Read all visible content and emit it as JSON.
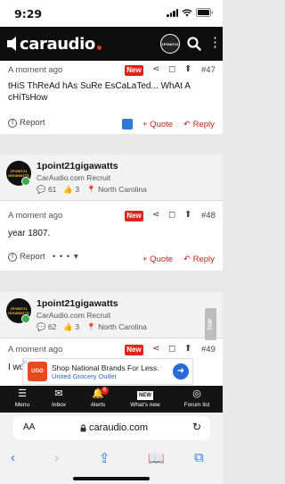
{
  "status_bar": {
    "time": "9:29"
  },
  "header": {
    "logo": "caraudio",
    "avatar_text": "1POINT21"
  },
  "posts": [
    {
      "time": "A moment ago",
      "badge": "New",
      "number": "#47",
      "body": "tHiS ThReAd hAs SuRe EsCaLaTed... WhAt A cHiTsHow",
      "report": "Report",
      "quote": "+ Quote",
      "reply": "Reply"
    },
    {
      "user": {
        "name": "1point21gigawatts",
        "title": "CarAudio.com Recruit",
        "messages": "61",
        "likes": "3",
        "location": "North Carolina",
        "avatar_text": "1POINT21 GIGAWATTS"
      },
      "time": "A moment ago",
      "badge": "New",
      "number": "#48",
      "body": "year 1807.",
      "report": "Report",
      "more": "• • •",
      "quote": "+ Quote",
      "reply": "Reply"
    },
    {
      "user": {
        "name": "1point21gigawatts",
        "title": "CarAudio.com Recruit",
        "messages": "62",
        "likes": "3",
        "location": "North Carolina",
        "avatar_text": "1POINT21 GIGAWATTS"
      },
      "time": "A moment ago",
      "badge": "New",
      "number": "#49",
      "body": "I wo"
    }
  ],
  "top_button": "TOP",
  "ad": {
    "title": "Shop National Brands For Less.",
    "subtitle": "United Grocery Outlet",
    "logo": "UGO"
  },
  "bottom_nav": [
    {
      "label": "Menu",
      "icon": "menu-icon"
    },
    {
      "label": "Inbox",
      "icon": "inbox-icon"
    },
    {
      "label": "Alerts",
      "icon": "bell-icon",
      "badge": "6"
    },
    {
      "label": "What's new",
      "icon": "new-icon"
    },
    {
      "label": "Forum list",
      "icon": "forum-icon"
    }
  ],
  "safari": {
    "aa": "AA",
    "url": "caraudio.com"
  },
  "colors": {
    "accent": "#c7281f",
    "badge": "#e0241b",
    "header": "#0d0d0d",
    "link": "#2f7bf5"
  }
}
